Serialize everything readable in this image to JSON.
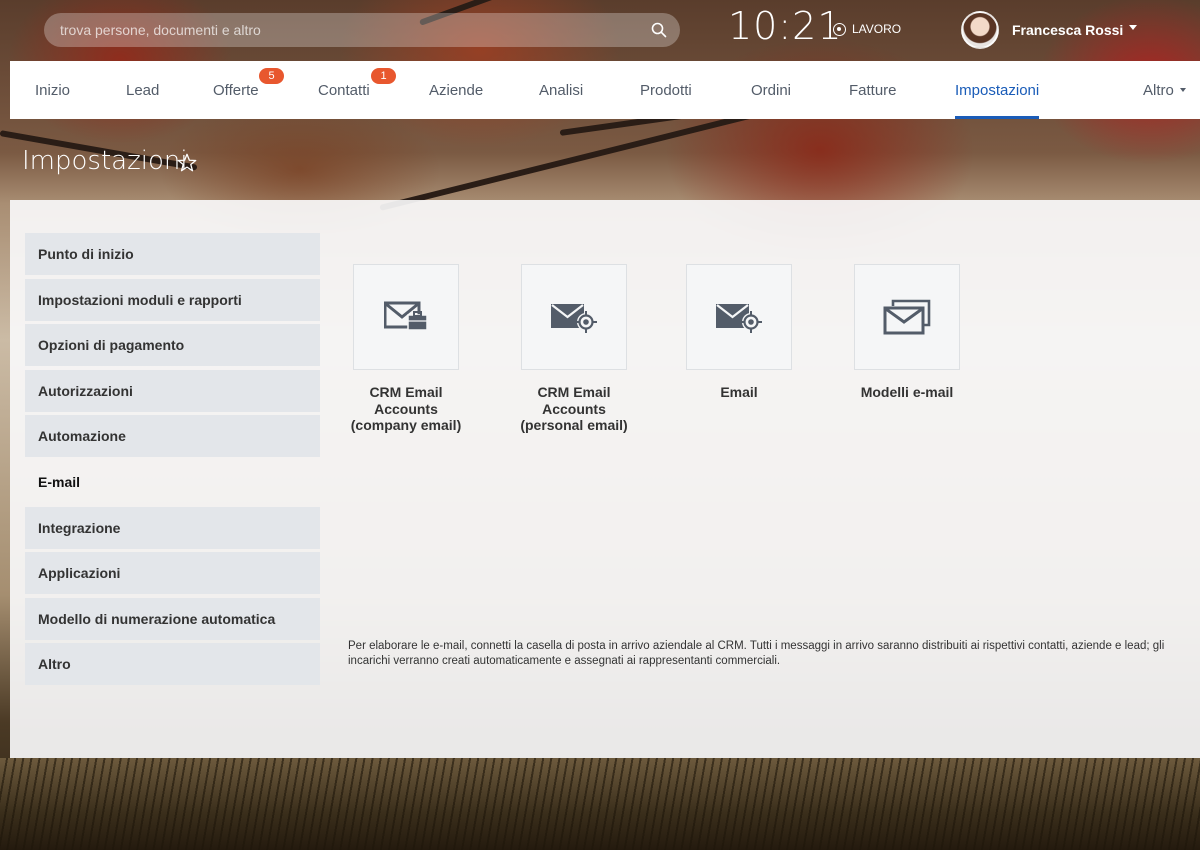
{
  "search": {
    "placeholder": "trova persone, documenti e altro"
  },
  "clock": "10:21",
  "work_status": "LAVORO",
  "user": {
    "name": "Francesca Rossi"
  },
  "nav": {
    "items": [
      {
        "label": "Inizio"
      },
      {
        "label": "Lead"
      },
      {
        "label": "Offerte",
        "badge": "5"
      },
      {
        "label": "Contatti",
        "badge": "1"
      },
      {
        "label": "Aziende"
      },
      {
        "label": "Analisi"
      },
      {
        "label": "Prodotti"
      },
      {
        "label": "Ordini"
      },
      {
        "label": "Fatture"
      },
      {
        "label": "Impostazioni",
        "active": true
      },
      {
        "label": "Altro"
      }
    ]
  },
  "page_title": "Impostazioni",
  "sidebar": {
    "items": [
      {
        "label": "Punto di inizio"
      },
      {
        "label": "Impostazioni moduli e rapporti"
      },
      {
        "label": "Opzioni di pagamento"
      },
      {
        "label": "Autorizzazioni"
      },
      {
        "label": "Automazione"
      },
      {
        "label": "E-mail",
        "active": true
      },
      {
        "label": "Integrazione"
      },
      {
        "label": "Applicazioni"
      },
      {
        "label": "Modello di numerazione automatica"
      },
      {
        "label": "Altro"
      }
    ]
  },
  "tiles": [
    {
      "label": "CRM Email\nAccounts\n(company email)",
      "icon": "mail-briefcase-icon"
    },
    {
      "label": "CRM Email\nAccounts\n(personal email)",
      "icon": "mail-target-icon"
    },
    {
      "label": "Email",
      "icon": "mail-target-icon"
    },
    {
      "label": "Modelli e-mail",
      "icon": "mail-stack-icon"
    }
  ],
  "info_text": "Per elaborare le e-mail, connetti la casella di posta in arrivo aziendale al CRM. Tutti i messaggi in arrivo saranno distribuiti ai rispettivi contatti, aziende e lead; gli incarichi verranno creati automaticamente e assegnati ai rappresentanti commerciali.",
  "colors": {
    "accent": "#1a5cb8",
    "badge": "#e8572e",
    "icon": "#535c69"
  }
}
